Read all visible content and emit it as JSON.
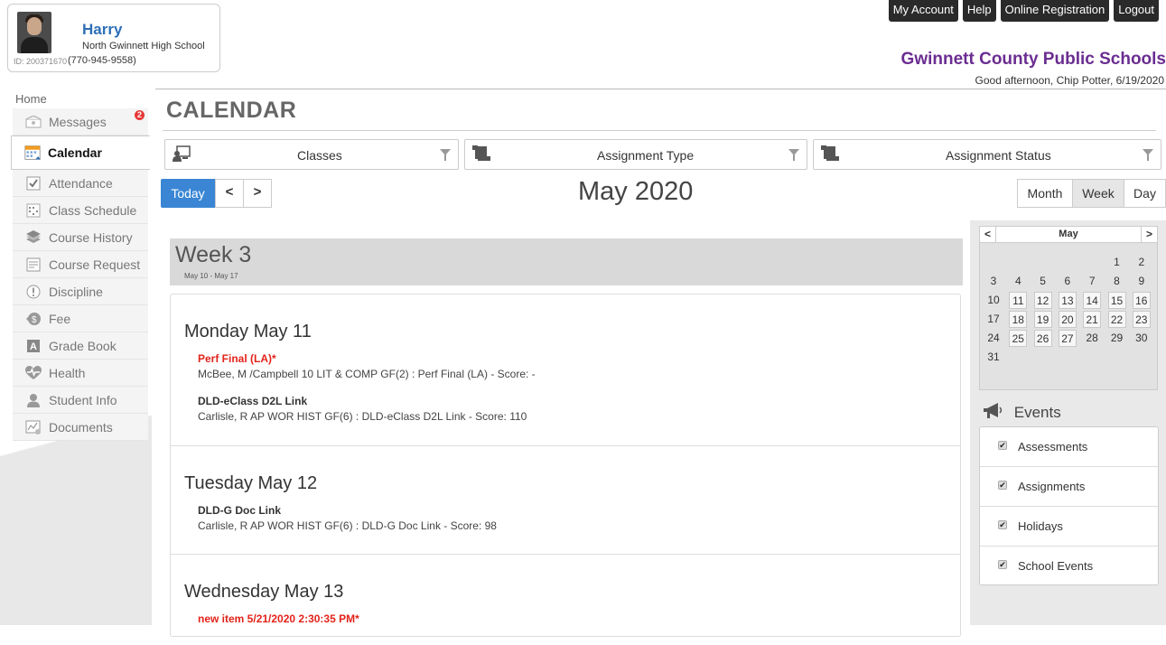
{
  "profile": {
    "name": "Harry",
    "school": "North Gwinnett High School",
    "id": "ID: 200371670",
    "phone": "(770-945-9558)"
  },
  "top_nav": [
    "My Account",
    "Help",
    "Online Registration",
    "Logout"
  ],
  "district": "Gwinnett County Public Schools",
  "greeting": "Good afternoon, Chip Potter, 6/19/2020",
  "sidebar": {
    "home": "Home",
    "items": [
      {
        "label": "Messages",
        "icon": "envelope-icon",
        "badge": "2"
      },
      {
        "label": "Calendar",
        "icon": "calendar-icon",
        "active": true
      },
      {
        "label": "Attendance",
        "icon": "checkbox-icon"
      },
      {
        "label": "Class Schedule",
        "icon": "schedule-grid-icon"
      },
      {
        "label": "Course History",
        "icon": "books-icon"
      },
      {
        "label": "Course Request",
        "icon": "form-icon"
      },
      {
        "label": "Discipline",
        "icon": "exclamation-circle-icon"
      },
      {
        "label": "Fee",
        "icon": "money-icon"
      },
      {
        "label": "Grade Book",
        "icon": "grade-a-icon"
      },
      {
        "label": "Health",
        "icon": "heartbeat-icon"
      },
      {
        "label": "Student Info",
        "icon": "person-icon"
      },
      {
        "label": "Documents",
        "icon": "chart-doc-icon"
      }
    ]
  },
  "page_title": "CALENDAR",
  "filters": {
    "classes": "Classes",
    "assignment_type": "Assignment Type",
    "assignment_status": "Assignment Status"
  },
  "toolbar": {
    "today": "Today",
    "prev": "<",
    "next": ">",
    "month_title": "May 2020",
    "views": [
      "Month",
      "Week",
      "Day"
    ],
    "active_view": "Week"
  },
  "week": {
    "title": "Week 3",
    "range": "May 10 - May 17"
  },
  "days": [
    {
      "heading": "Monday May 11",
      "items": [
        {
          "title": "Perf Final (LA)*",
          "detail": "McBee, M /Campbell 10 LIT & COMP GF(2) : Perf Final (LA) - Score: -",
          "style": "red"
        },
        {
          "title": "DLD-eClass D2L Link",
          "detail": "Carlisle, R AP WOR HIST GF(6) : DLD-eClass D2L Link - Score: 110",
          "style": "dark"
        }
      ]
    },
    {
      "heading": "Tuesday May 12",
      "items": [
        {
          "title": "DLD-G Doc Link",
          "detail": "Carlisle, R AP WOR HIST GF(6) : DLD-G Doc Link - Score: 98",
          "style": "dark"
        }
      ]
    },
    {
      "heading": "Wednesday May 13",
      "items": [
        {
          "title": "new item 5/21/2020 2:30:35 PM*",
          "detail": "",
          "style": "red"
        }
      ]
    }
  ],
  "mini_calendar": {
    "month": "May",
    "prev": "<",
    "next": ">",
    "weeks": [
      [
        "",
        "",
        "",
        "",
        "",
        "1",
        "2"
      ],
      [
        "3",
        "4",
        "5",
        "6",
        "7",
        "8",
        "9"
      ],
      [
        "10",
        "11",
        "12",
        "13",
        "14",
        "15",
        "16"
      ],
      [
        "17",
        "18",
        "19",
        "20",
        "21",
        "22",
        "23"
      ],
      [
        "24",
        "25",
        "26",
        "27",
        "28",
        "29",
        "30"
      ],
      [
        "31",
        "",
        "",
        "",
        "",
        "",
        ""
      ]
    ],
    "boxed_days": [
      "11",
      "12",
      "13",
      "14",
      "15",
      "16",
      "18",
      "19",
      "20",
      "21",
      "22",
      "23",
      "25",
      "26",
      "27"
    ]
  },
  "events": {
    "title": "Events",
    "items": [
      "Assessments",
      "Assignments",
      "Holidays",
      "School Events"
    ]
  },
  "colors": {
    "accent": "#3a86d4",
    "district": "#6b2d91",
    "name": "#2e6fb7",
    "highlight_red": "#e2231a"
  }
}
